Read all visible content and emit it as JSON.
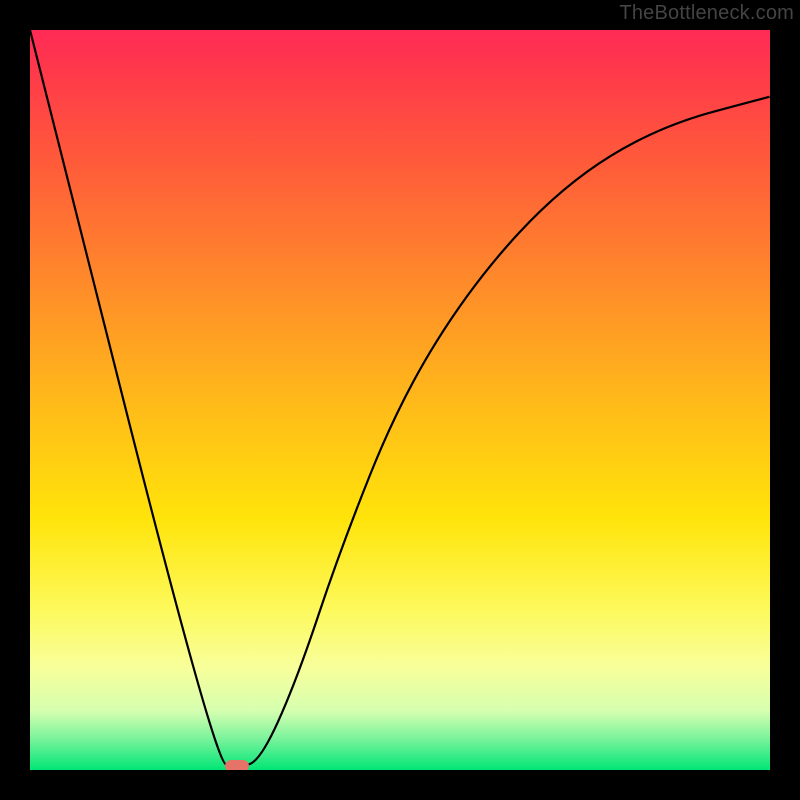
{
  "watermark": "TheBottleneck.com",
  "chart_data": {
    "type": "line",
    "title": "",
    "xlabel": "",
    "ylabel": "",
    "xlim": [
      0,
      100
    ],
    "ylim": [
      0,
      100
    ],
    "grid": false,
    "curve_points": [
      {
        "x": 0,
        "y": 100
      },
      {
        "x": 25,
        "y": 1
      },
      {
        "x": 28,
        "y": 0.5
      },
      {
        "x": 31,
        "y": 1
      },
      {
        "x": 36,
        "y": 12
      },
      {
        "x": 42,
        "y": 30
      },
      {
        "x": 50,
        "y": 50
      },
      {
        "x": 60,
        "y": 66
      },
      {
        "x": 72,
        "y": 79
      },
      {
        "x": 85,
        "y": 87
      },
      {
        "x": 100,
        "y": 91
      }
    ],
    "dip": {
      "x": 28,
      "y": 0.5
    },
    "marker_color": "#e57368",
    "curve_color": "#000000",
    "background_gradient": [
      "#ff2a55",
      "#ff5b3a",
      "#ffb91a",
      "#fdf95a",
      "#00e676"
    ]
  }
}
